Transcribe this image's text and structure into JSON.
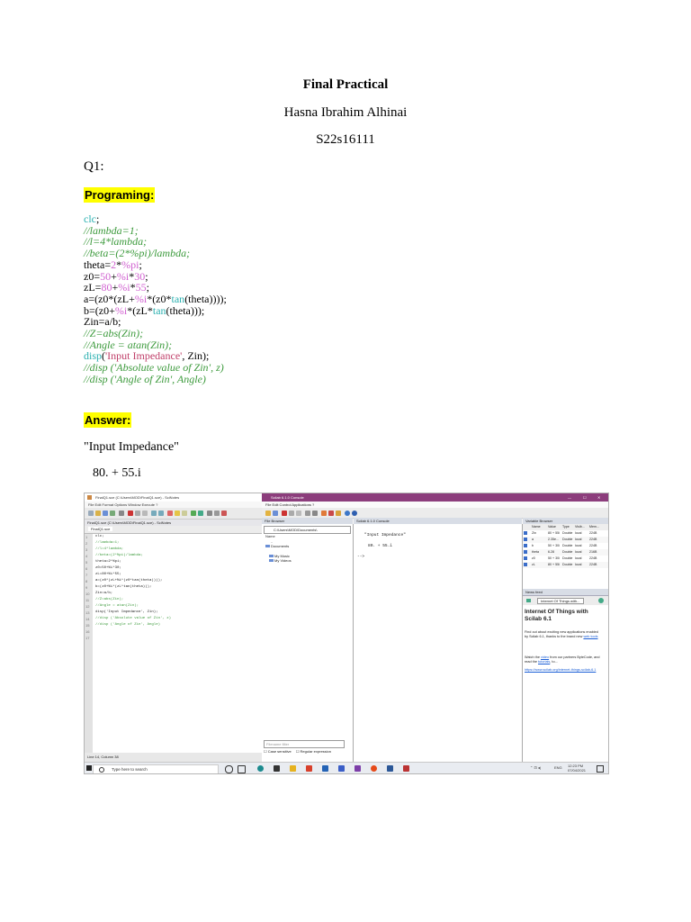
{
  "document": {
    "title": "Final Practical",
    "author": "Hasna Ibrahim Alhinai",
    "student_id": "S22s16111",
    "question": "Q1:",
    "programming_heading": "Programing:",
    "code_lines": [
      [
        "clc",
        ";"
      ],
      [
        "//lambda=1;"
      ],
      [
        "//l=4*lambda;"
      ],
      [
        "//beta=(2*%pi)/lambda;"
      ],
      [
        "theta=",
        "2",
        "*",
        "%pi",
        ";"
      ],
      [
        "z0=",
        "50",
        "+",
        "%i",
        "*",
        "30",
        ";"
      ],
      [
        "zL=",
        "80",
        "+",
        "%i",
        "*",
        "55",
        ";"
      ],
      [
        "a=(z0*(zL+",
        "%i",
        "*(z0*",
        "tan",
        "(theta))));"
      ],
      [
        "b=(z0+",
        "%i",
        "*(zL*",
        "tan",
        "(theta)));"
      ],
      [
        "Zin=a/b;"
      ],
      [
        "//Z=abs(Zin);"
      ],
      [
        "//Angle = atan(Zin);"
      ],
      [
        "disp",
        "(",
        "'Input Impedance'",
        ", Zin);"
      ],
      [
        "//disp ('Absolute value of Zin', z)"
      ],
      [
        "//disp ('Angle of Zin', Angle)"
      ]
    ],
    "answer_heading": "Answer:",
    "answer_label": "\"Input Impedance\"",
    "answer_value": "80. + 55.i"
  },
  "screenshot": {
    "editor": {
      "window_title": "FinalQ1.sce (C:\\Users\\MOD\\FinalQ1.sce) - SciNotes",
      "menu": "File  Edit  Format  Options  Window  Execute  ?",
      "path": "FinalQ1.sce (C:\\Users\\MOD\\FinalQ1.sce) - SciNotes",
      "tab": "FinalQ1.sce",
      "lines": [
        "clc;",
        "//lambda=1;",
        "//l=4*lambda;",
        "//beta=(2*%pi)/lambda;",
        "theta=2*%pi;",
        "z0=50+%i*30;",
        "zL=80+%i*55;",
        "a=(z0*(zL+%i*(z0*tan(theta))));",
        "b=(z0+%i*(zL*tan(theta)));",
        "Zin=a/b;",
        "//Z=abs(Zin);",
        "//Angle = atan(Zin);",
        "disp('Input Impedance', Zin);",
        "//disp ('Absolute value of Zin', z)",
        "//disp ('Angle of Zin', Angle)",
        "",
        ""
      ],
      "status": "Line 14, Column 38"
    },
    "console": {
      "window_title": "Scilab 6.1.0 Console",
      "menu": "File  Edit  Control  Applications  ?",
      "file_browser_title": "File Browser",
      "file_path": "C:\\Users\\MOD\\Documents\\",
      "column_name": "Name",
      "tree": [
        "..",
        "Documents",
        "My Music",
        "My Videos"
      ],
      "filter_placeholder": "Filename filter",
      "option_case": "Case sensitive",
      "option_regex": "Regular expression",
      "console_title": "Scilab 6.1.0 Console",
      "output_label": "\"Input Impedance\"",
      "output_value": "80. + 55.i",
      "prompt": "-->",
      "var_browser_title": "Variable Browser",
      "var_headers": [
        "Name",
        "Value",
        "Type",
        "Visib...",
        "Mem..."
      ],
      "vars": [
        [
          "Zin",
          "80 + 55i",
          "Double",
          "local",
          "224B"
        ],
        [
          "a",
          "2.35e...",
          "Double",
          "local",
          "224B"
        ],
        [
          "b",
          "50 + 30i",
          "Double",
          "local",
          "224B"
        ],
        [
          "theta",
          "6.28",
          "Double",
          "local",
          "216B"
        ],
        [
          "z0",
          "50 + 30i",
          "Double",
          "local",
          "224B"
        ],
        [
          "zL",
          "80 + 55i",
          "Double",
          "local",
          "224B"
        ]
      ],
      "news_title": "News feed",
      "news_item": "Internet Of Things with...",
      "news_heading_1": "Internet Of Things with",
      "news_heading_2": "Scilab 6.1",
      "news_p1_a": "Find out about exciting new applications enabled",
      "news_p1_b": "by Scilab 6.1, thanks to the brand new",
      "news_p1_link": "web tools",
      "news_p2_a": "Watch the",
      "news_p2_link": "video",
      "news_p2_b": "from our partners ByteCode, and",
      "news_p2_c": "read the",
      "news_p2_link2": "tutorials",
      "news_p2_d": ", to...",
      "news_url": "https://www.scilab.org/internet-things-scilab-6.1"
    },
    "taskbar": {
      "search_placeholder": "Type here to search",
      "lang": "ENG",
      "time": "12:23 PM",
      "date": "07/04/2021"
    }
  }
}
